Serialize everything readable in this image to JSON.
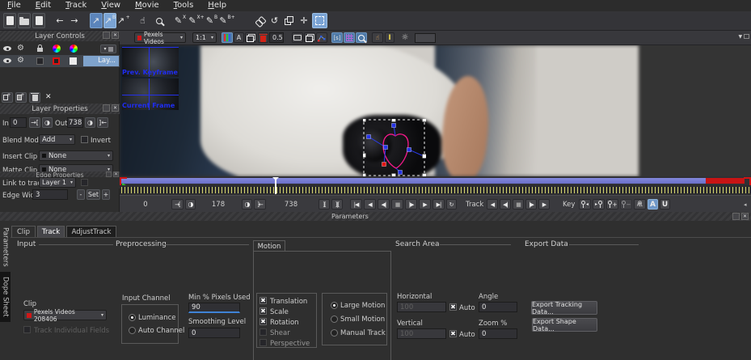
{
  "icons": {
    "check": "✖",
    "arrow_down": "▼",
    "arrow_down_small": "▾",
    "back": "←",
    "forward": "→",
    "cursor": "↖",
    "pen": "✎",
    "hand": "☝",
    "gear": "⚙",
    "sun": "☼",
    "move": "✛",
    "rotate": "↺",
    "half_circle": "◑",
    "in_point": "→[",
    "out_point": "]←",
    "tl_zoom_in": "][",
    "tl_zoom_out": "]|[",
    "go_start": "|◀",
    "play_back": "◀",
    "frame_back": "◀|",
    "stop": "■",
    "frame_fwd": "|▶",
    "play": "▶",
    "go_end": "▶|",
    "loop": "↻",
    "key_prev": "◂",
    "key_next": "▸",
    "key_add": "+",
    "key_del": "−",
    "key_del_all": "⊗",
    "overflow": "◂",
    "close": "✕",
    "expand": "✕",
    "plus": "+",
    "green_marker": "▶"
  },
  "menubar": {
    "items": [
      "File",
      "Edit",
      "Track",
      "View",
      "Movie",
      "Tools",
      "Help"
    ]
  },
  "toolbar": {
    "cursor_b_label": "B",
    "cursor_plus_label": "+",
    "pen_x_label": "X",
    "pen_x_plus_label": "X+",
    "pen_b_label": "B",
    "pen_b_plus_label": "B+"
  },
  "view_toolbar": {
    "clip_menu": "Pexels Videos",
    "zoom_level": "1:1",
    "channel_label": "A",
    "mask_opacity": "0.5",
    "stabilize_label": "[s]",
    "ibeam_label": "I"
  },
  "layer_controls": {
    "title": "Layer Controls",
    "layer_name": "Lay..."
  },
  "layer_properties": {
    "title": "Layer Properties",
    "in_label": "In",
    "in_value": "0",
    "out_label": "Out",
    "out_value": "738",
    "blend_mode_label": "Blend Mode",
    "blend_mode_value": "Add",
    "invert_label": "Invert",
    "insert_clip_label": "Insert Clip",
    "insert_clip_value": "None",
    "matte_clip_label": "Matte Clip",
    "matte_clip_value": "None",
    "link_to_track_label": "Link to track",
    "link_to_track_value": "Layer 1",
    "edge_width_label": "Edge Width",
    "edge_width_value": "3",
    "decrement_label": "-",
    "set_label": "Set",
    "increment_label": "+"
  },
  "edge_properties": {
    "title": "Edge Properties"
  },
  "viewer": {
    "prev_keyframe_label": "Prev. Keyframe",
    "current_frame_label": "Current Frame"
  },
  "timeline": {
    "in_value": "0",
    "current_frame": "178",
    "out_value": "738",
    "track_label": "Track",
    "key_label": "Key",
    "autokey_label": "A",
    "u_label": "U",
    "all_label": "ALL"
  },
  "parameters": {
    "panel_title": "Parameters",
    "side_tab_parameters": "Parameters",
    "side_tab_dope_sheet": "Dope Sheet",
    "tabs": [
      "Clip",
      "Track",
      "AdjustTrack"
    ],
    "input": {
      "section": "Input",
      "clip_label": "Clip",
      "clip_value": "Pexels Videos 208406",
      "track_fields_label": "Track Individual Fields"
    },
    "preprocessing": {
      "section": "Preprocessing",
      "input_channel_label": "Input Channel",
      "luminance_label": "Luminance",
      "auto_channel_label": "Auto Channel",
      "min_pixels_label": "Min % Pixels Used",
      "min_pixels_value": "90",
      "smoothing_label": "Smoothing Level",
      "smoothing_value": "0"
    },
    "motion": {
      "section": "Motion",
      "checkboxes": [
        {
          "label": "Translation",
          "checked": true
        },
        {
          "label": "Scale",
          "checked": true
        },
        {
          "label": "Rotation",
          "checked": true
        },
        {
          "label": "Shear",
          "checked": false
        },
        {
          "label": "Perspective",
          "checked": false
        }
      ],
      "radios": [
        {
          "label": "Large Motion",
          "selected": true
        },
        {
          "label": "Small Motion",
          "selected": false
        },
        {
          "label": "Manual Track",
          "selected": false
        }
      ]
    },
    "search_area": {
      "section": "Search Area",
      "horizontal_label": "Horizontal",
      "horizontal_value": "100",
      "vertical_label": "Vertical",
      "vertical_value": "100",
      "auto_label": "Auto",
      "angle_label": "Angle",
      "angle_value": "0",
      "zoom_label": "Zoom %",
      "zoom_value": "0"
    },
    "export_data": {
      "section": "Export Data",
      "export_tracking_label": "Export Tracking Data...",
      "export_shape_label": "Export Shape Data..."
    }
  }
}
